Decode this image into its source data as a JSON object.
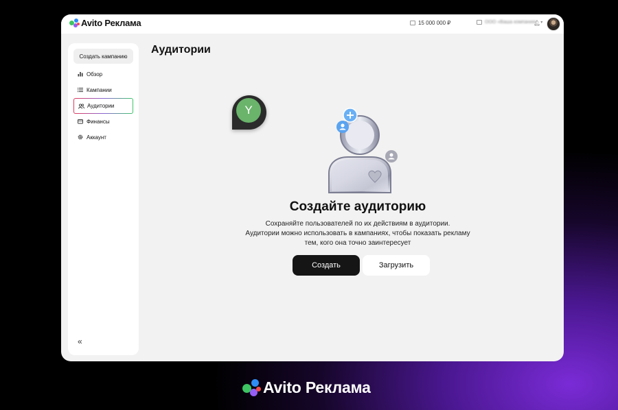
{
  "app": {
    "brand": "Avito Реклама",
    "balance": "15 000 000 ₽",
    "company": "ООО «Ваша компания»"
  },
  "sidebar": {
    "create_label": "Создать кампанию",
    "items": [
      {
        "label": "Обзор",
        "icon": "chart-icon"
      },
      {
        "label": "Кампании",
        "icon": "list-icon"
      },
      {
        "label": "Аудитории",
        "icon": "users-icon"
      },
      {
        "label": "Финансы",
        "icon": "wallet-icon"
      },
      {
        "label": "Аккаунт",
        "icon": "gear-icon"
      }
    ],
    "active_index": 2,
    "collapse_label": "«"
  },
  "main": {
    "title": "Аудитории",
    "empty_title": "Создайте аудиторию",
    "desc_line1": "Сохраняйте пользователей по их действиям в аудитории.",
    "desc_line2": "Аудитории можно использовать в кампаниях, чтобы показать рекламу",
    "desc_line3": "тем, кого она точно заинтересует",
    "primary_button": "Создать",
    "secondary_button": "Загрузить"
  },
  "overlay": {
    "user_initial": "Y"
  },
  "footer": {
    "brand": "Avito Реклама"
  },
  "colors": {
    "dot_green": "#3ec463",
    "dot_blue": "#2f8cf5",
    "dot_red": "#f24b4b",
    "dot_purple": "#965ef5",
    "primary": "#151515",
    "accent_blue": "#5aa3f0"
  }
}
